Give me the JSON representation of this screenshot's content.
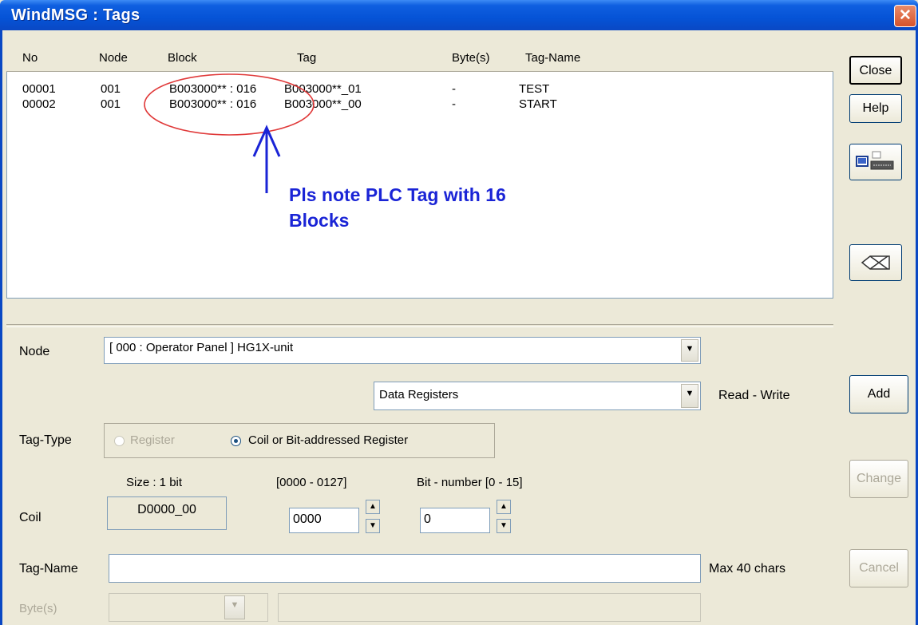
{
  "window": {
    "title": "WindMSG : Tags",
    "close_glyph": "✕"
  },
  "list": {
    "columns": [
      "No",
      "Node",
      "Block",
      "Tag",
      "Byte(s)",
      "Tag-Name"
    ],
    "rows": [
      {
        "no": "00001",
        "node": "001",
        "block": "B003000** : 016",
        "tag": "B003000**_01",
        "bytes": "-",
        "tag_name": "TEST"
      },
      {
        "no": "00002",
        "node": "001",
        "block": "B003000** : 016",
        "tag": "B003000**_00",
        "bytes": "-",
        "tag_name": "START"
      }
    ]
  },
  "annotation": {
    "text_line1": "Pls note PLC Tag with 16",
    "text_line2": "Blocks",
    "color": "#1a24d6"
  },
  "side_buttons": {
    "close": "Close",
    "help": "Help",
    "add": "Add",
    "change": "Change",
    "cancel": "Cancel"
  },
  "form": {
    "node_label": "Node",
    "node_value": "[ 000 : Operator Panel ]  HG1X-unit",
    "area_value": "Data Registers",
    "access_text": "Read - Write",
    "tag_type_label": "Tag-Type",
    "tag_type_register": "Register",
    "tag_type_coil": "Coil or Bit-addressed Register",
    "size_text": "Size : 1 bit",
    "range_text": "[0000 - 0127]",
    "bit_range_text": "Bit - number [0 - 15]",
    "coil_label": "Coil",
    "coil_value": "D0000_00",
    "address_value": "0000",
    "bit_value": "0",
    "tag_name_label": "Tag-Name",
    "tag_name_value": "",
    "max_chars_text": "Max 40 chars",
    "bytes_label": "Byte(s)"
  }
}
